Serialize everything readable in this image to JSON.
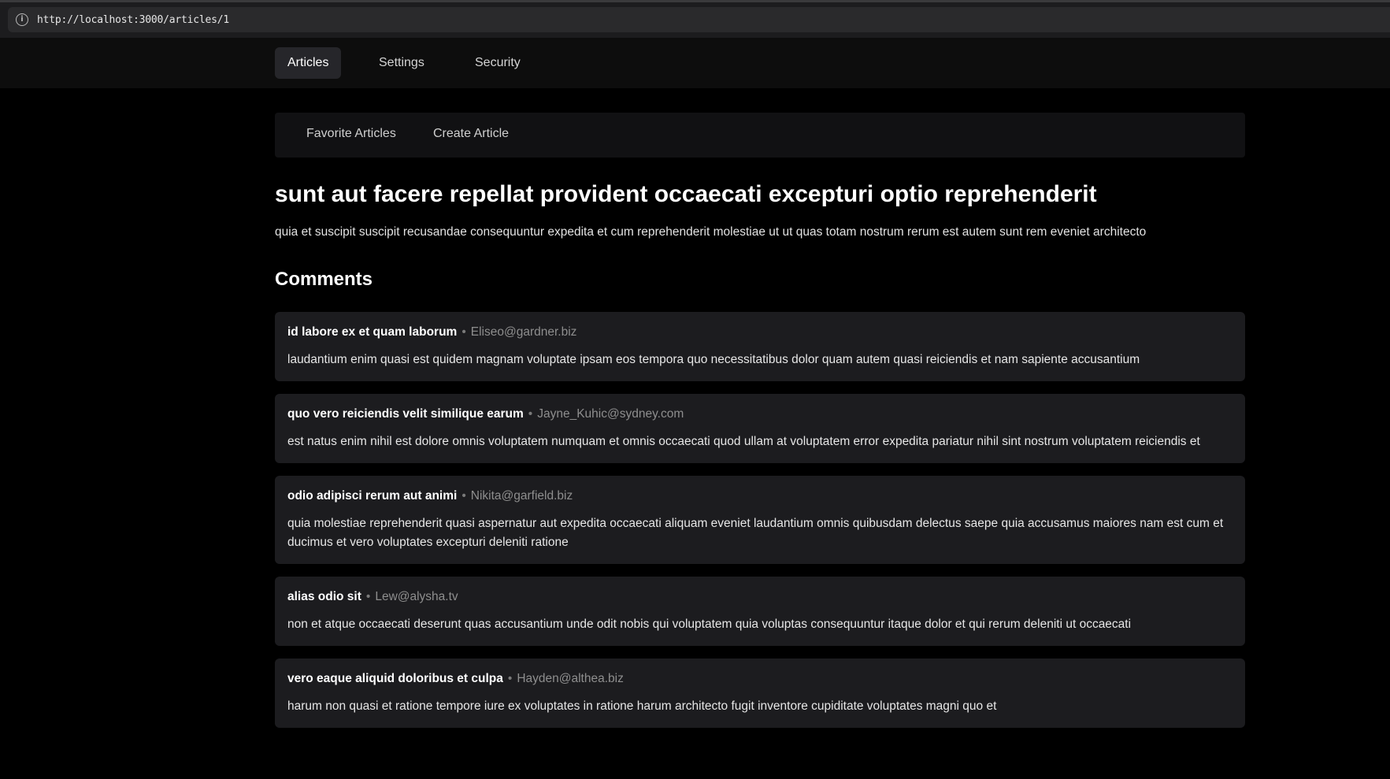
{
  "browser": {
    "url": "http://localhost:3000/articles/1"
  },
  "topnav": {
    "tabs": [
      {
        "label": "Articles",
        "active": true
      },
      {
        "label": "Settings",
        "active": false
      },
      {
        "label": "Security",
        "active": false
      }
    ]
  },
  "subnav": {
    "links": [
      {
        "label": "Favorite Articles"
      },
      {
        "label": "Create Article"
      }
    ]
  },
  "article": {
    "title": "sunt aut facere repellat provident occaecati excepturi optio reprehenderit",
    "body": "quia et suscipit suscipit recusandae consequuntur expedita et cum reprehenderit molestiae ut ut quas totam nostrum rerum est autem sunt rem eveniet architecto"
  },
  "comments": {
    "heading": "Comments",
    "separator": "•",
    "items": [
      {
        "name": "id labore ex et quam laborum",
        "email": "Eliseo@gardner.biz",
        "body": "laudantium enim quasi est quidem magnam voluptate ipsam eos tempora quo necessitatibus dolor quam autem quasi reiciendis et nam sapiente accusantium"
      },
      {
        "name": "quo vero reiciendis velit similique earum",
        "email": "Jayne_Kuhic@sydney.com",
        "body": "est natus enim nihil est dolore omnis voluptatem numquam et omnis occaecati quod ullam at voluptatem error expedita pariatur nihil sint nostrum voluptatem reiciendis et"
      },
      {
        "name": "odio adipisci rerum aut animi",
        "email": "Nikita@garfield.biz",
        "body": "quia molestiae reprehenderit quasi aspernatur aut expedita occaecati aliquam eveniet laudantium omnis quibusdam delectus saepe quia accusamus maiores nam est cum et ducimus et vero voluptates excepturi deleniti ratione"
      },
      {
        "name": "alias odio sit",
        "email": "Lew@alysha.tv",
        "body": "non et atque occaecati deserunt quas accusantium unde odit nobis qui voluptatem quia voluptas consequuntur itaque dolor et qui rerum deleniti ut occaecati"
      },
      {
        "name": "vero eaque aliquid doloribus et culpa",
        "email": "Hayden@althea.biz",
        "body": "harum non quasi et ratione tempore iure ex voluptates in ratione harum architecto fugit inventore cupiditate voluptates magni quo et"
      }
    ]
  }
}
